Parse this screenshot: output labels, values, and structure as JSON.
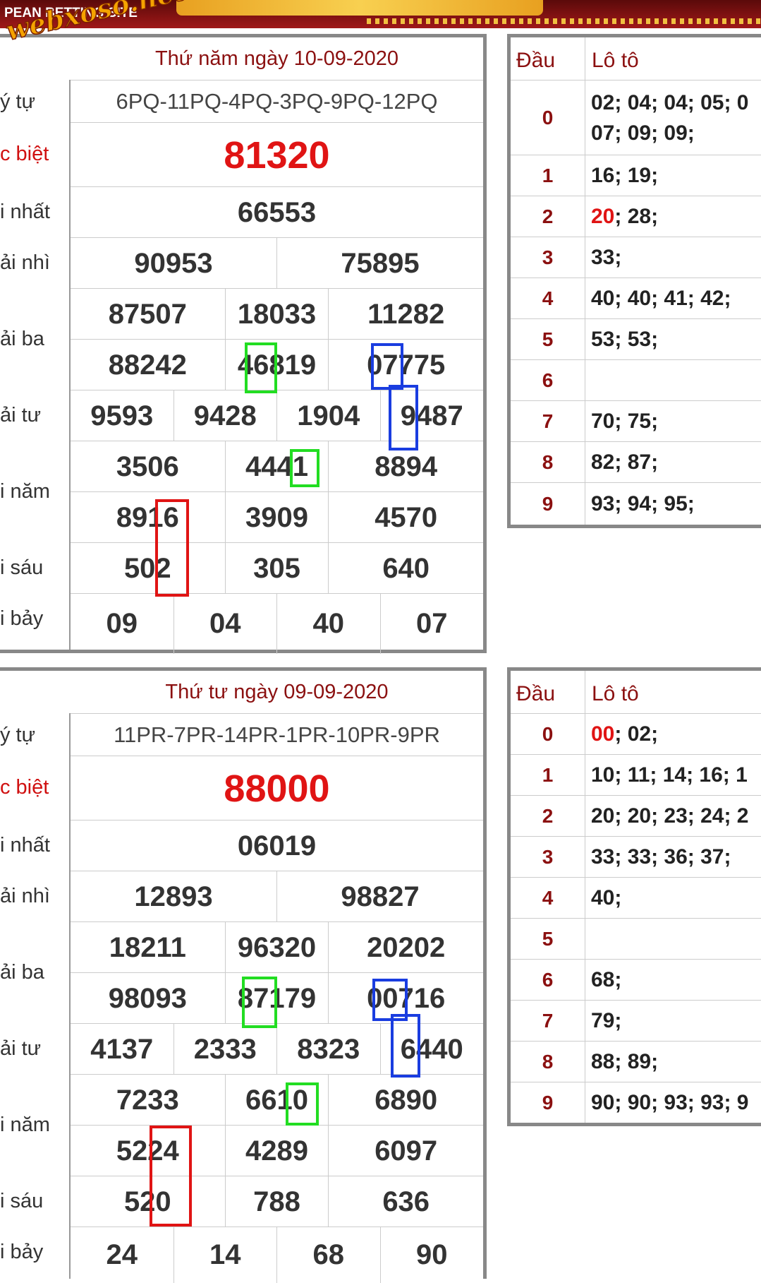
{
  "banner": {
    "text": "PEAN BETTING SITE"
  },
  "watermark": "webxoso.net",
  "labels": [
    "ý tự",
    "c biệt",
    "i nhất",
    "ải nhì",
    "ải ba",
    "ải tư",
    "i năm",
    "i sáu",
    "i bảy"
  ],
  "draws": [
    {
      "title": "Thứ năm ngày 10-09-2020",
      "symbols": "6PQ-11PQ-4PQ-3PQ-9PQ-12PQ",
      "special": "81320",
      "first": "66553",
      "second": [
        "90953",
        "75895"
      ],
      "third": [
        [
          "87507",
          "18033",
          "11282"
        ],
        [
          "88242",
          "46819",
          "07775"
        ]
      ],
      "fourth": [
        "9593",
        "9428",
        "1904",
        "9487"
      ],
      "fifth": [
        [
          "3506",
          "4441",
          "8894"
        ],
        [
          "8916",
          "3909",
          "4570"
        ]
      ],
      "sixth": [
        "502",
        "305",
        "640"
      ],
      "seventh": [
        "09",
        "04",
        "40",
        "07"
      ],
      "loto_header": {
        "dau": "Đầu",
        "loto": "Lô tô"
      },
      "loto": [
        {
          "d": "0",
          "v": "02; 04; 04; 05; 0",
          "v2": "07; 09; 09;"
        },
        {
          "d": "1",
          "v": "16; 19;"
        },
        {
          "d": "2",
          "hl": "20",
          "v": "; 28;"
        },
        {
          "d": "3",
          "v": "33;"
        },
        {
          "d": "4",
          "v": "40; 40; 41; 42;"
        },
        {
          "d": "5",
          "v": "53; 53;"
        },
        {
          "d": "6",
          "v": ""
        },
        {
          "d": "7",
          "v": "70; 75;"
        },
        {
          "d": "8",
          "v": "82; 87;"
        },
        {
          "d": "9",
          "v": "93; 94; 95;"
        }
      ]
    },
    {
      "title": "Thứ tư ngày 09-09-2020",
      "symbols": "11PR-7PR-14PR-1PR-10PR-9PR",
      "special": "88000",
      "first": "06019",
      "second": [
        "12893",
        "98827"
      ],
      "third": [
        [
          "18211",
          "96320",
          "20202"
        ],
        [
          "98093",
          "87179",
          "00716"
        ]
      ],
      "fourth": [
        "4137",
        "2333",
        "8323",
        "6440"
      ],
      "fifth": [
        [
          "7233",
          "6610",
          "6890"
        ],
        [
          "5224",
          "4289",
          "6097"
        ]
      ],
      "sixth": [
        "520",
        "788",
        "636"
      ],
      "seventh": [
        "24",
        "14",
        "68",
        "90"
      ],
      "loto_header": {
        "dau": "Đầu",
        "loto": "Lô tô"
      },
      "loto": [
        {
          "d": "0",
          "hl": "00",
          "v": "; 02;"
        },
        {
          "d": "1",
          "v": "10; 11; 14; 16; 1"
        },
        {
          "d": "2",
          "v": "20; 20; 23; 24; 2"
        },
        {
          "d": "3",
          "v": "33; 33; 36; 37;"
        },
        {
          "d": "4",
          "v": "40;"
        },
        {
          "d": "5",
          "v": ""
        },
        {
          "d": "6",
          "v": "68;"
        },
        {
          "d": "7",
          "v": "79;"
        },
        {
          "d": "8",
          "v": "88; 89;"
        },
        {
          "d": "9",
          "v": "90; 90; 93; 93; 9"
        }
      ]
    }
  ],
  "colors": {
    "special": "#e01414",
    "title": "#8b1010",
    "green_box": "#22dd22",
    "blue_box": "#1a3de0",
    "red_box": "#e01414"
  }
}
